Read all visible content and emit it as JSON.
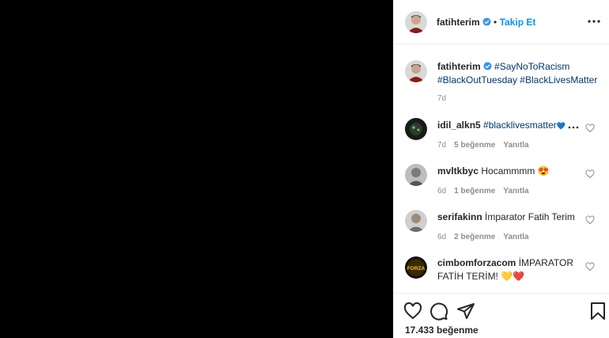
{
  "post": {
    "author": "fatihterim",
    "follow_label": "Takip Et",
    "caption": {
      "author": "fatihterim",
      "tags_line1": "#SayNoToRacism",
      "tags_line2a": "#BlackOutTuesday",
      "tags_line2b": "#BlackLivesMatter",
      "time": "7d"
    },
    "comments": [
      {
        "user": "idil_alkn5",
        "text": "#blacklivesmatter",
        "emoji": "💙",
        "time": "7d",
        "likes": "5 beğenme",
        "reply": "Yanıtla"
      },
      {
        "user": "mvltkbyc",
        "text": "Hocammmm",
        "emoji": "😍",
        "time": "6d",
        "likes": "1 beğenme",
        "reply": "Yanıtla"
      },
      {
        "user": "serifakinn",
        "text": "İmparator Fatih Terim",
        "time": "6d",
        "likes": "2 beğenme",
        "reply": "Yanıtla"
      },
      {
        "user": "cimbomforzacom",
        "text_line1": "İMPARATOR",
        "text_line2": "FATİH TERİM!",
        "emoji": "💛❤️",
        "avatar_text": "FORZA"
      }
    ],
    "like_count": "17.433 beğenme"
  },
  "colors": {
    "link": "#0095f6",
    "hashtag": "#00376b",
    "muted": "#8e8e8e",
    "media_bg": "#000000"
  },
  "icons": [
    "verified-badge-icon",
    "more-options-icon",
    "heart-icon",
    "comment-icon",
    "share-icon",
    "bookmark-icon"
  ]
}
